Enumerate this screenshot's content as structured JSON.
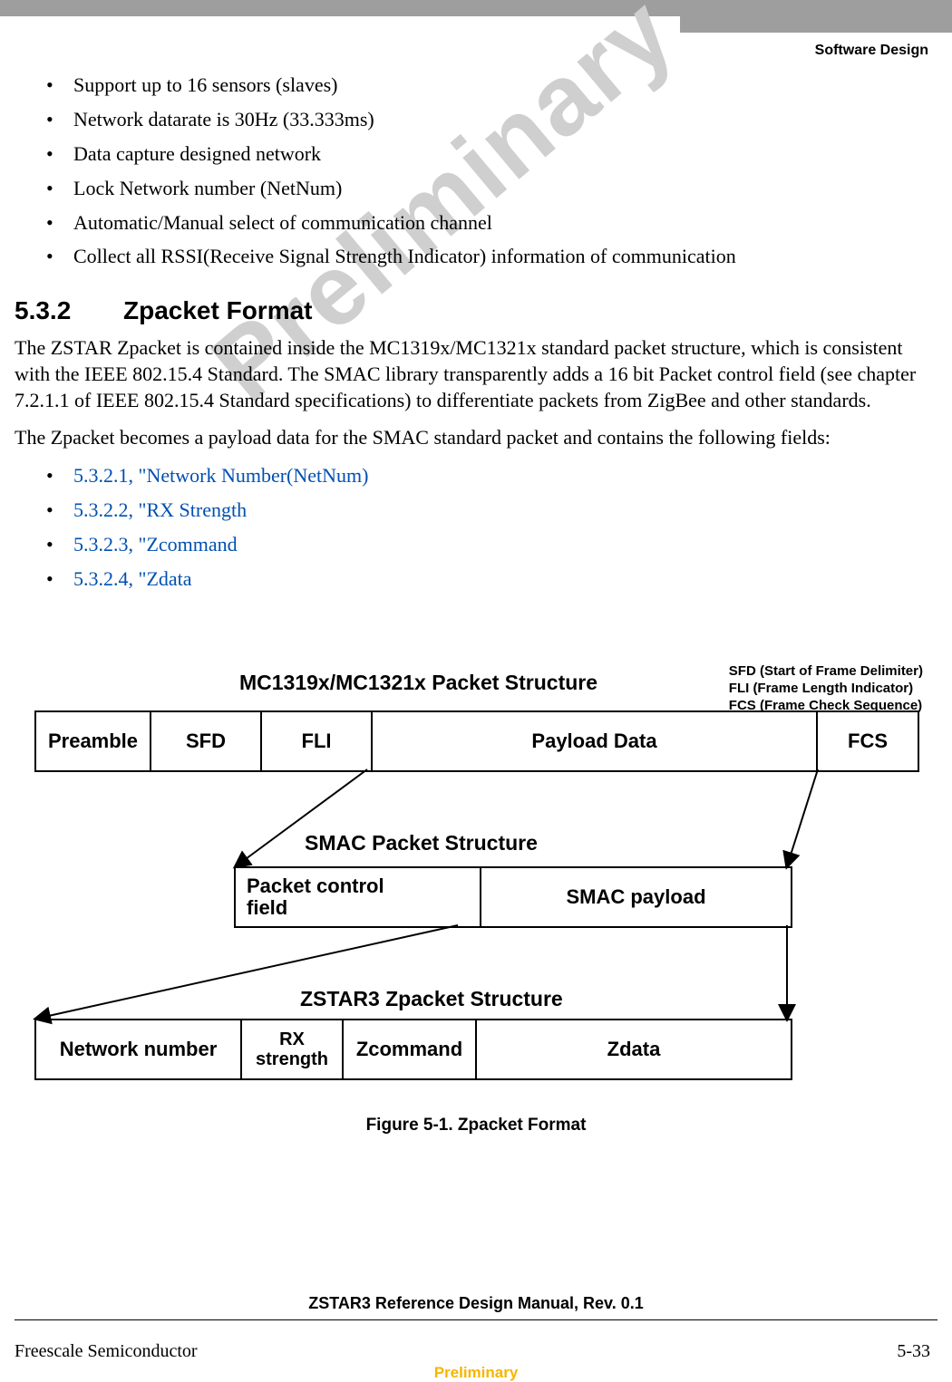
{
  "header": {
    "section": "Software Design"
  },
  "watermark": "Preliminary",
  "bullets": [
    "Support up to 16 sensors (slaves)",
    "Network datarate is 30Hz (33.333ms)",
    "Data capture designed network",
    "Lock Network number (NetNum)",
    "Automatic/Manual select of communication channel",
    "Collect all RSSI(Receive Signal Strength Indicator) information of communication"
  ],
  "section": {
    "number": "5.3.2",
    "title": "Zpacket Format"
  },
  "para1": "The ZSTAR Zpacket is contained inside the MC1319x/MC1321x standard packet structure, which is consistent with the IEEE 802.15.4 Standard. The SMAC library transparently adds a 16 bit Packet control field (see chapter 7.2.1.1 of IEEE 802.15.4 Standard specifications) to differentiate packets from ZigBee and other standards.",
  "para2": "The Zpacket becomes a payload data for the SMAC standard packet and contains the following fields:",
  "links": [
    "5.3.2.1, \"Network Number(NetNum)",
    "5.3.2.2, \"RX Strength",
    "5.3.2.3, \"Zcommand",
    "5.3.2.4, \"Zdata"
  ],
  "figure": {
    "title1": "MC1319x/MC1321x Packet Structure",
    "legend": {
      "l1": "SFD (Start of Frame Delimiter)",
      "l2": "FLI (Frame Length Indicator)",
      "l3": "FCS (Frame Check Sequence)"
    },
    "t1": {
      "preamble": "Preamble",
      "sfd": "SFD",
      "fli": "FLI",
      "payload": "Payload Data",
      "fcs": "FCS"
    },
    "title2": "SMAC Packet Structure",
    "t2": {
      "pc1": "Packet control",
      "pc2": "field",
      "payload": "SMAC payload"
    },
    "title3": "ZSTAR3 Zpacket Structure",
    "t3": {
      "nn": "Network number",
      "rx1": "RX",
      "rx2": "strength",
      "zc": "Zcommand",
      "zd": "Zdata"
    },
    "caption": "Figure 5-1. Zpacket Format"
  },
  "footer": {
    "doc": "ZSTAR3 Reference Design Manual, Rev. 0.1",
    "left": "Freescale Semiconductor",
    "right": "5-33",
    "prelim": "Preliminary"
  }
}
